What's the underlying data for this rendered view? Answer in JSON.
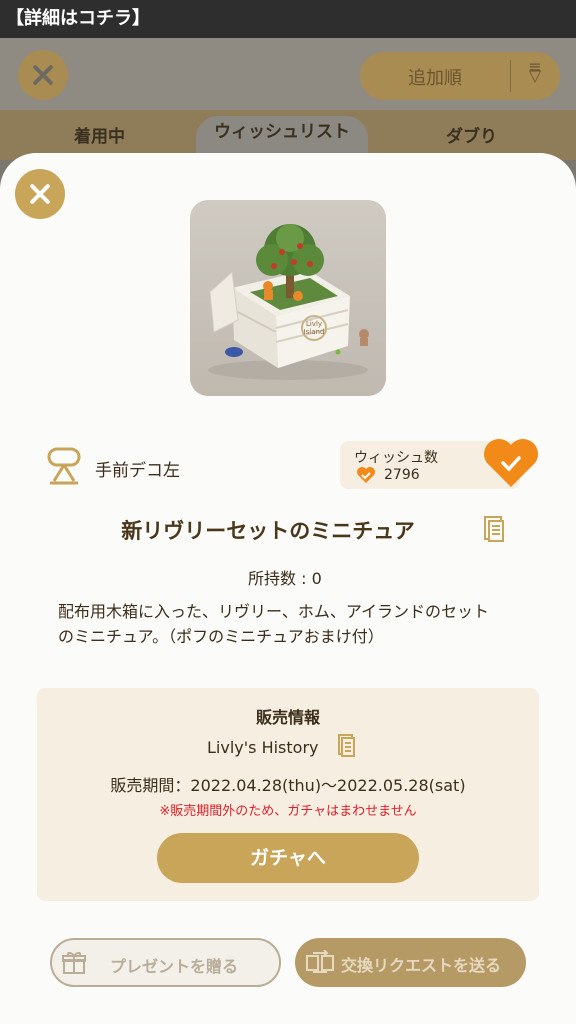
{
  "topbar": {
    "text": "【詳細はコチラ】"
  },
  "background": {
    "sort_label": "追加順",
    "tabs": [
      "着用中",
      "ウィッシュリスト",
      "ダブり"
    ]
  },
  "item": {
    "slot": "手前デコ左",
    "wish_label": "ウィッシュ数",
    "wish_count": "2796",
    "title": "新リヴリーセットのミニチュア",
    "owned": "所持数 : 0",
    "description": "配布用木箱に入った、リヴリー、ホム、アイランドのセットのミニチュア。（ポフのミニチュアおまけ付）"
  },
  "sale": {
    "heading": "販売情報",
    "name": "Livly's History",
    "period": "販売期間：2022.04.28(thu)～2022.05.28(sat)",
    "note": "※販売期間外のため、ガチャはまわせません",
    "gacha_button": "ガチャへ"
  },
  "actions": {
    "present": "プレゼントを贈る",
    "trade": "交換リクエストを送る"
  },
  "colors": {
    "accent_gold": "#c9a55a",
    "heart_orange": "#f28a1a",
    "warning_red": "#e0202a",
    "panel_beige": "#f6efe1"
  }
}
